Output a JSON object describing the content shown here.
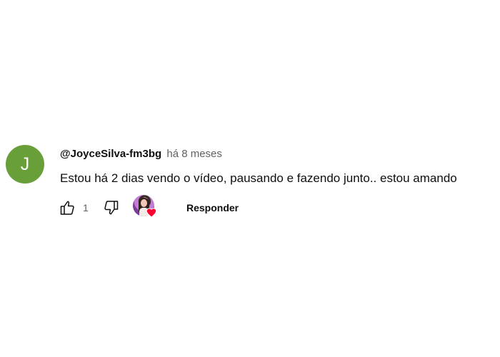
{
  "comment": {
    "avatar_letter": "J",
    "avatar_color": "#689f38",
    "author": "@JoyceSilva-fm3bg",
    "published_time": "há 8 meses",
    "text": "Estou há 2 dias vendo o vídeo, pausando e fazendo junto.. estou amando",
    "like_count": "1",
    "icons": {
      "like": "thumb-up-icon",
      "dislike": "thumb-down-icon",
      "creator_heart": "heart-icon"
    },
    "heart_color": "#ff0033",
    "reply_label": "Responder"
  }
}
